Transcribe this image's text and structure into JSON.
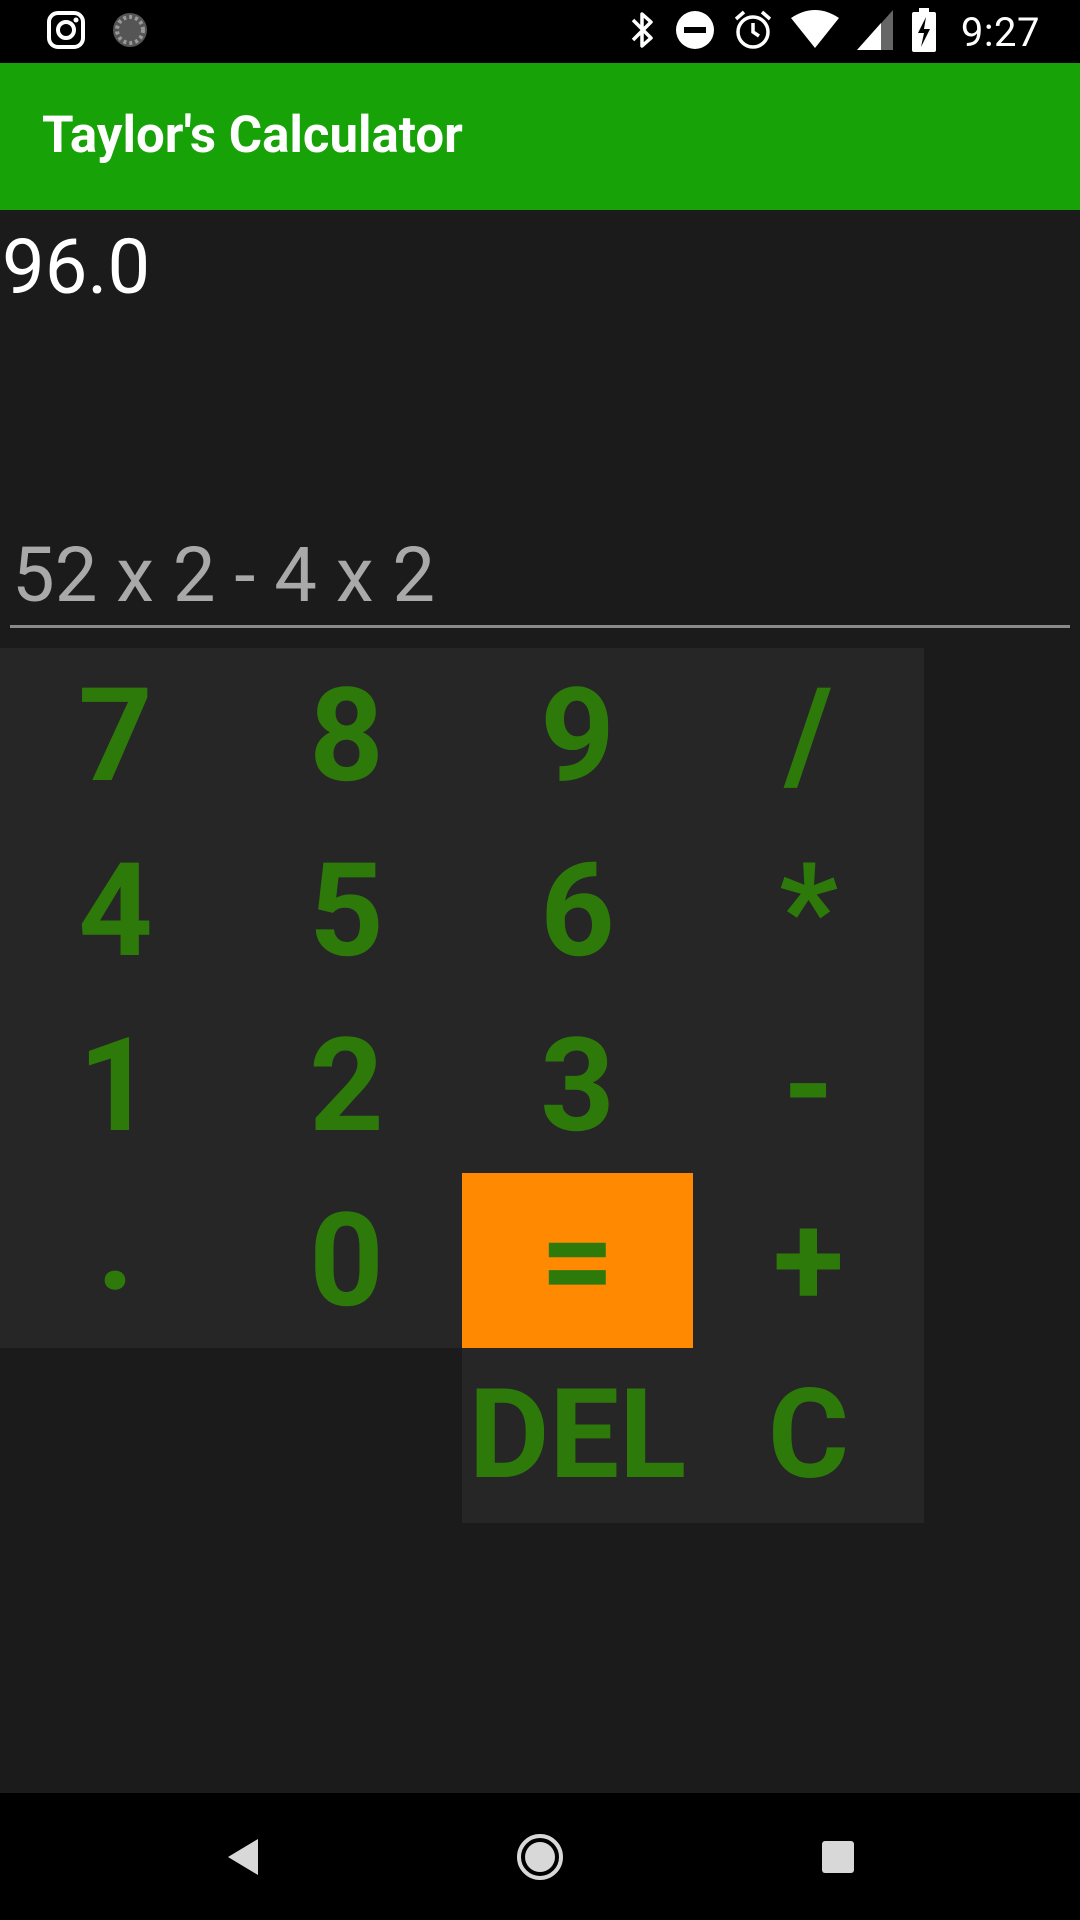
{
  "status_bar": {
    "time": "9:27",
    "left_icons": [
      "instagram-icon",
      "loading-icon"
    ],
    "right_icons": [
      "bluetooth-icon",
      "do-not-disturb-icon",
      "alarm-icon",
      "wifi-icon",
      "cell-signal-icon",
      "battery-charging-icon"
    ]
  },
  "app_bar": {
    "title": "Taylor's Calculator",
    "color": "#17a307"
  },
  "display": {
    "result": "96.0",
    "expression": "52 x 2 - 4 x 2"
  },
  "keypad": {
    "rows": [
      [
        "7",
        "8",
        "9",
        "/"
      ],
      [
        "4",
        "5",
        "6",
        "*"
      ],
      [
        "1",
        "2",
        "3",
        "-"
      ],
      [
        ".",
        "0",
        "=",
        "+"
      ]
    ],
    "extra": [
      "DEL",
      "C"
    ],
    "key_color": "#2d7a0a",
    "equals_color": "#ff8900"
  },
  "nav_bar": {
    "icons": [
      "back-icon",
      "home-icon",
      "recents-icon"
    ]
  }
}
